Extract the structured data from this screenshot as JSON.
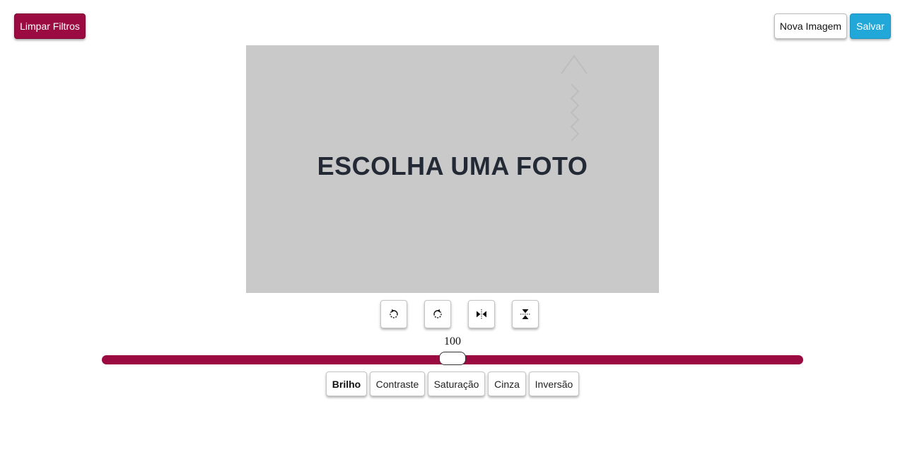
{
  "header": {
    "clear_label": "Limpar Filtros",
    "new_image_label": "Nova Imagem",
    "save_label": "Salvar"
  },
  "preview": {
    "placeholder_text": "ESCOLHA UMA FOTO"
  },
  "tools": [
    {
      "name": "rotate-left",
      "icon": "rotate-left-icon"
    },
    {
      "name": "rotate-right",
      "icon": "rotate-right-icon"
    },
    {
      "name": "flip-horizontal",
      "icon": "flip-horizontal-icon"
    },
    {
      "name": "flip-vertical",
      "icon": "flip-vertical-icon"
    }
  ],
  "slider": {
    "value": "100",
    "min": 0,
    "max": 200,
    "level_fraction": 0.5
  },
  "filters": [
    {
      "label": "Brilho",
      "active": true
    },
    {
      "label": "Contraste",
      "active": false
    },
    {
      "label": "Saturação",
      "active": false
    },
    {
      "label": "Cinza",
      "active": false
    },
    {
      "label": "Inversão",
      "active": false
    }
  ],
  "colors": {
    "accent": "#9c0a42",
    "save": "#22a8d8",
    "preview_bg": "#c9c9c9",
    "placeholder_text": "#232a36"
  }
}
